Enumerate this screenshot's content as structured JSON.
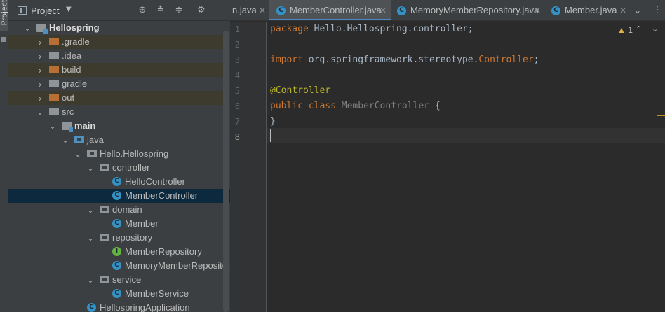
{
  "side_stripe": {
    "project_label": "Project"
  },
  "project_panel": {
    "title": "Project",
    "tree": [
      {
        "label": "Hellospring",
        "bold": true,
        "icon": "module-folder-icon",
        "arrow": "down"
      },
      {
        "label": ".gradle",
        "icon": "folder-excluded-icon",
        "arrow": "right",
        "excluded": true
      },
      {
        "label": ".idea",
        "icon": "folder-icon",
        "arrow": "right"
      },
      {
        "label": "build",
        "icon": "folder-excluded-icon",
        "arrow": "right",
        "excluded": true
      },
      {
        "label": "gradle",
        "icon": "folder-icon",
        "arrow": "right"
      },
      {
        "label": "out",
        "icon": "folder-excluded-icon",
        "arrow": "right",
        "excluded": true
      },
      {
        "label": "src",
        "icon": "folder-icon",
        "arrow": "down"
      },
      {
        "label": "main",
        "bold": true,
        "icon": "module-folder-icon",
        "arrow": "down"
      },
      {
        "label": "java",
        "icon": "source-folder-icon",
        "arrow": "down"
      },
      {
        "label": "Hello.Hellospring",
        "icon": "package-icon",
        "arrow": "down"
      },
      {
        "label": "controller",
        "icon": "package-icon",
        "arrow": "down"
      },
      {
        "label": "HelloController",
        "icon": "class-icon"
      },
      {
        "label": "MemberController",
        "icon": "class-icon",
        "selected": true
      },
      {
        "label": "domain",
        "icon": "package-icon",
        "arrow": "down"
      },
      {
        "label": "Member",
        "icon": "class-icon"
      },
      {
        "label": "repository",
        "icon": "package-icon",
        "arrow": "down"
      },
      {
        "label": "MemberRepository",
        "icon": "interface-icon"
      },
      {
        "label": "MemoryMemberRepository",
        "icon": "class-icon"
      },
      {
        "label": "service",
        "icon": "package-icon",
        "arrow": "down"
      },
      {
        "label": "MemberService",
        "icon": "class-icon"
      },
      {
        "label": "HellospringApplication",
        "icon": "spring-class-icon"
      }
    ]
  },
  "editor": {
    "tabs": [
      {
        "label": "n.java",
        "active": false
      },
      {
        "label": "MemberController.java",
        "active": true
      },
      {
        "label": "MemoryMemberRepository.java",
        "active": false
      },
      {
        "label": "Member.java",
        "active": false
      }
    ],
    "class_badge": "C",
    "interface_badge": "I",
    "warning_count": "1",
    "line_numbers": [
      "1",
      "2",
      "3",
      "4",
      "5",
      "6",
      "7",
      "8"
    ],
    "code": {
      "line1_kw": "package",
      "line1_rest": " Hello.Hellospring.controller;",
      "line3_kw": "import",
      "line3_rest": " org.springframework.stereotype.",
      "line3_cls": "Controller",
      "line3_end": ";",
      "line5": "@Controller",
      "line6_kw1": "public",
      "line6_kw2": "class",
      "line6_name": "MemberController",
      "line6_brace": " {",
      "line7": "}"
    }
  },
  "colors": {
    "accent": "#4a88c7",
    "keyword": "#cc7832",
    "annotation": "#bbb529",
    "warning": "#e3b341",
    "selected_row": "#0d293e"
  }
}
